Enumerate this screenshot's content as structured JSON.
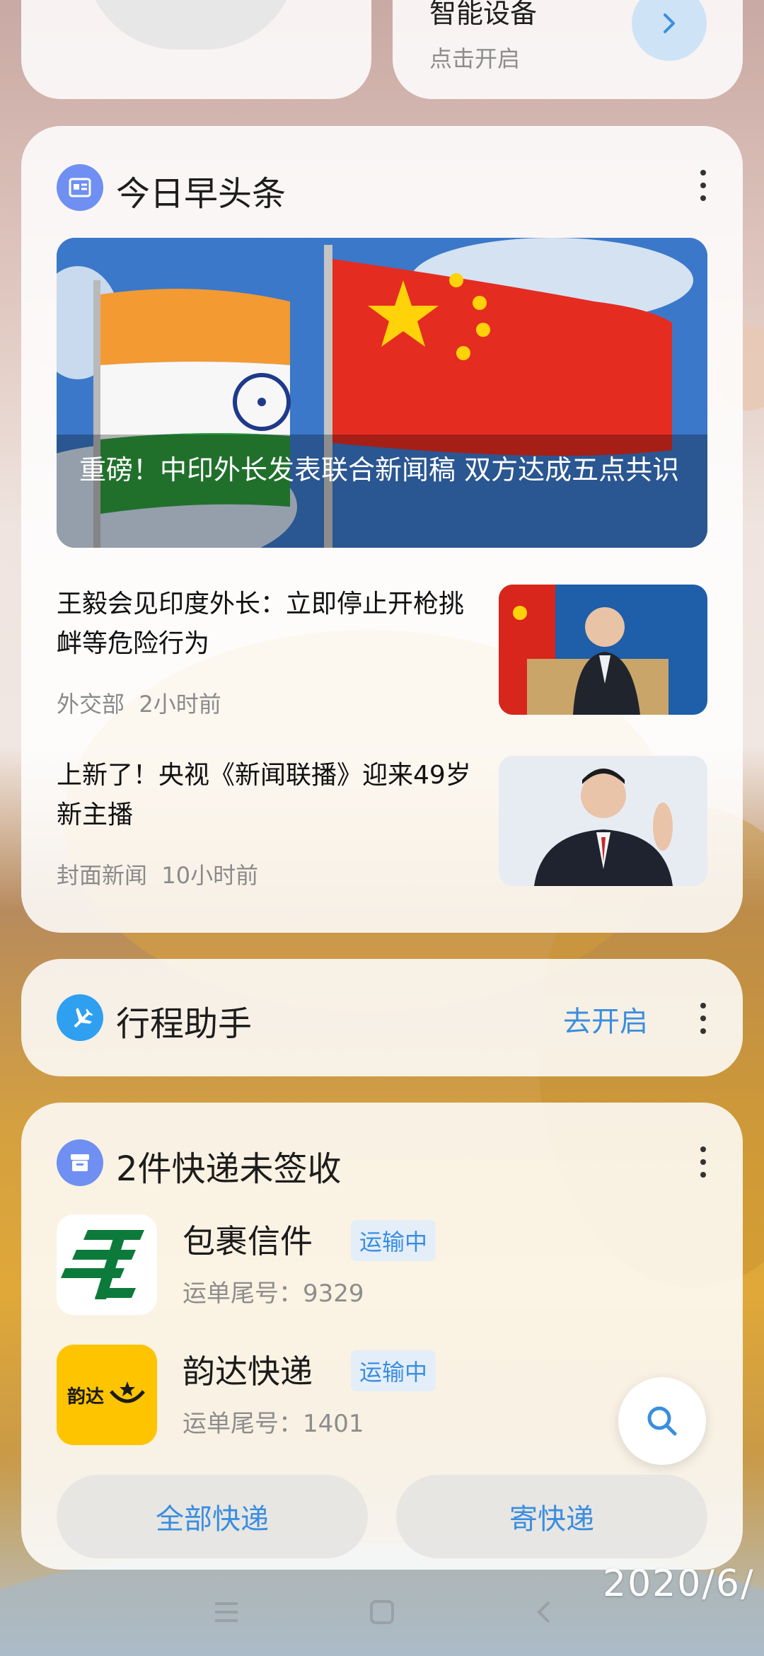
{
  "top_card": {
    "title": "智能设备",
    "subtitle": "点击开启"
  },
  "news_card": {
    "title": "今日早头条",
    "hero_caption": "重磅！中印外长发表联合新闻稿 双方达成五点共识",
    "items": [
      {
        "title": "王毅会见印度外长：立即停止开枪挑衅等危险行为",
        "source": "外交部",
        "time": "2小时前"
      },
      {
        "title": "上新了！央视《新闻联播》迎来49岁新主播",
        "source": "封面新闻",
        "time": "10小时前"
      }
    ]
  },
  "trip_card": {
    "title": "行程助手",
    "action": "去开启"
  },
  "express_card": {
    "title": "2件快递未签收",
    "packages": [
      {
        "name": "包裹信件",
        "status": "运输中",
        "tracking": "运单尾号：9329"
      },
      {
        "name": "韵达快递",
        "status": "运输中",
        "tracking": "运单尾号：1401",
        "logo_text": "韵达"
      }
    ],
    "buttons": {
      "all": "全部快递",
      "send": "寄快递"
    }
  },
  "date_text": "2020/6/",
  "colors": {
    "accent": "#3a8ee0",
    "news_icon": "#6f8ff2",
    "trip_icon": "#2f9ff0",
    "yunda": "#ffc400",
    "ems_green": "#0c7a3a"
  },
  "icons": [
    "news-icon",
    "plane-icon",
    "package-icon",
    "chevron-right-icon",
    "more-icon",
    "search-icon"
  ]
}
